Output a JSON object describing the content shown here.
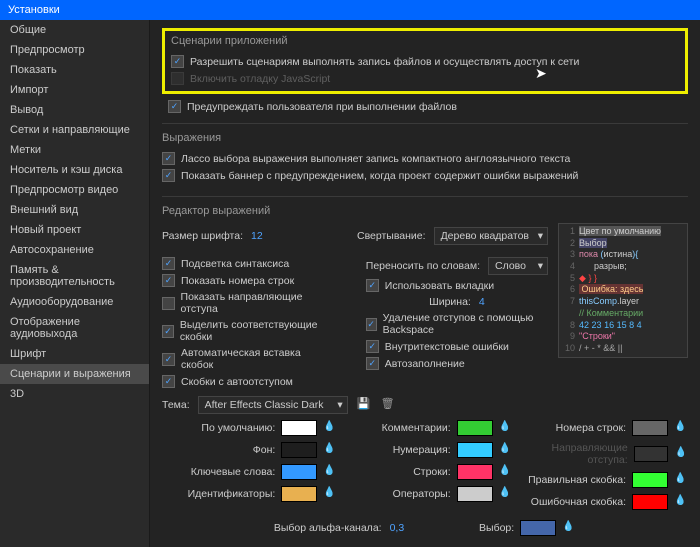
{
  "window": {
    "title": "Установки"
  },
  "sidebar": {
    "items": [
      {
        "label": "Общие"
      },
      {
        "label": "Предпросмотр"
      },
      {
        "label": "Показать"
      },
      {
        "label": "Импорт"
      },
      {
        "label": "Вывод"
      },
      {
        "label": "Сетки и направляющие"
      },
      {
        "label": "Метки"
      },
      {
        "label": "Носитель и кэш диска"
      },
      {
        "label": "Предпросмотр видео"
      },
      {
        "label": "Внешний вид"
      },
      {
        "label": "Новый проект"
      },
      {
        "label": "Автосохранение"
      },
      {
        "label": "Память & производительность"
      },
      {
        "label": "Аудиооборудование"
      },
      {
        "label": "Отображение аудиовыхода"
      },
      {
        "label": "Шрифт"
      },
      {
        "label": "Сценарии и выражения",
        "active": true
      },
      {
        "label": "3D"
      }
    ]
  },
  "sections": {
    "scripting": {
      "title": "Сценарии приложений",
      "opt1": "Разрешить сценариям выполнять запись файлов и осуществлять доступ к сети",
      "opt2": "Включить отладку JavaScript",
      "opt3": "Предупреждать пользователя при выполнении файлов"
    },
    "expressions": {
      "title": "Выражения",
      "opt1": "Лассо выбора выражения выполняет запись компактного англоязычного текста",
      "opt2": "Показать баннер с предупреждением, когда проект содержит ошибки выражений"
    },
    "editor": {
      "title": "Редактор выражений",
      "fontSize": {
        "label": "Размер шрифта:",
        "value": "12"
      },
      "folding": {
        "label": "Свертывание:",
        "value": "Дерево квадратов"
      },
      "left": [
        {
          "label": "Подсветка синтаксиса",
          "checked": true
        },
        {
          "label": "Показать номера строк",
          "checked": true
        },
        {
          "label": "Показать направляющие отступа",
          "checked": false
        },
        {
          "label": "Выделить соответствующие скобки",
          "checked": true
        },
        {
          "label": "Автоматическая вставка скобок",
          "checked": true
        },
        {
          "label": "Скобки с автоотступом",
          "checked": true
        }
      ],
      "wordwrap": {
        "label": "Переносить по словам:",
        "value": "Слово"
      },
      "right": [
        {
          "label": "Использовать вкладки",
          "checked": true
        },
        {
          "label": "Удаление отступов с помощью Backspace",
          "checked": true
        },
        {
          "label": "Внутритекстовые ошибки",
          "checked": true
        },
        {
          "label": "Автозаполнение",
          "checked": true
        }
      ],
      "width": {
        "label": "Ширина:",
        "value": "4"
      }
    },
    "code": {
      "lines": [
        {
          "n": "1",
          "html": "<span style='color:#ccc;background:#555'>Цвет по умолчанию</span>"
        },
        {
          "n": "2",
          "html": "<span style='color:#ccc;background:#446'>Выбор</span>"
        },
        {
          "n": "3",
          "html": "<span style='color:#d8a'>пока</span> <span style='color:#8cf'>(</span>истина<span style='color:#8cf'>){</span>"
        },
        {
          "n": "4",
          "html": "&nbsp;&nbsp;&nbsp;&nbsp;&nbsp;&nbsp;разрыв;"
        },
        {
          "n": "5",
          "html": "<span style='color:#f44'>◆</span> <span style='color:#f44'>} }</span>"
        },
        {
          "n": "6",
          "html": "<span style='background:#663333;color:#fc8'>&nbsp;Ошибка: здесь</span>"
        },
        {
          "n": "7",
          "html": "<span style='color:#8cf'>thisComp</span>.layer"
        },
        {
          "n": "",
          "html": "<span style='color:#6a6'>// Комментарии</span>"
        },
        {
          "n": "8",
          "html": "<span style='color:#5bf'>42</span> <span style='color:#5bf'>23</span> <span style='color:#5bf'>16</span> <span style='color:#5bf'>15</span> <span style='color:#5bf'>8</span> <span style='color:#5bf'>4</span>"
        },
        {
          "n": "9",
          "html": "<span style='color:#e7a'>\"Строки\"</span>"
        },
        {
          "n": "10",
          "html": "<span style='color:#aaa'>/ + - * && ||</span>"
        }
      ]
    },
    "theme": {
      "label": "Тема:",
      "value": "After Effects Classic Dark"
    },
    "colors": {
      "left": [
        {
          "label": "По умолчанию:",
          "color": "#ffffff"
        },
        {
          "label": "Фон:",
          "color": "#1e1e1e"
        },
        {
          "label": "Ключевые слова:",
          "color": "#3399ff"
        },
        {
          "label": "Идентификаторы:",
          "color": "#e8b050"
        }
      ],
      "mid": [
        {
          "label": "Комментарии:",
          "color": "#33cc33"
        },
        {
          "label": "Нумерация:",
          "color": "#33ccff"
        },
        {
          "label": "Строки:",
          "color": "#ff3366"
        },
        {
          "label": "Операторы:",
          "color": "#cccccc"
        }
      ],
      "right": [
        {
          "label": "Номера строк:",
          "color": "#666666"
        },
        {
          "label": "Направляющие отступа:",
          "color": "#333333",
          "dim": true
        },
        {
          "label": "Правильная скобка:",
          "color": "#33ff33"
        },
        {
          "label": "Ошибочная скобка:",
          "color": "#ff0000"
        }
      ],
      "alpha": {
        "label": "Выбор альфа-канала:",
        "value": "0,3"
      },
      "selection": {
        "label": "Выбор:",
        "color": "#4466aa"
      }
    }
  }
}
